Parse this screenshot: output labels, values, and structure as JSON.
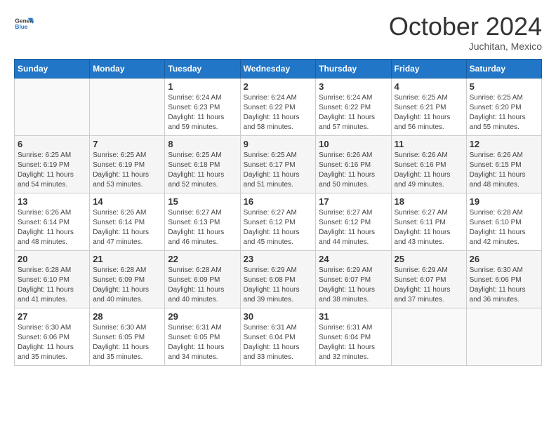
{
  "header": {
    "logo": {
      "general": "General",
      "blue": "Blue"
    },
    "title": "October 2024",
    "subtitle": "Juchitan, Mexico"
  },
  "calendar": {
    "days_of_week": [
      "Sunday",
      "Monday",
      "Tuesday",
      "Wednesday",
      "Thursday",
      "Friday",
      "Saturday"
    ],
    "weeks": [
      [
        {
          "day": "",
          "sunrise": "",
          "sunset": "",
          "daylight": ""
        },
        {
          "day": "",
          "sunrise": "",
          "sunset": "",
          "daylight": ""
        },
        {
          "day": "1",
          "sunrise": "Sunrise: 6:24 AM",
          "sunset": "Sunset: 6:23 PM",
          "daylight": "Daylight: 11 hours and 59 minutes."
        },
        {
          "day": "2",
          "sunrise": "Sunrise: 6:24 AM",
          "sunset": "Sunset: 6:22 PM",
          "daylight": "Daylight: 11 hours and 58 minutes."
        },
        {
          "day": "3",
          "sunrise": "Sunrise: 6:24 AM",
          "sunset": "Sunset: 6:22 PM",
          "daylight": "Daylight: 11 hours and 57 minutes."
        },
        {
          "day": "4",
          "sunrise": "Sunrise: 6:25 AM",
          "sunset": "Sunset: 6:21 PM",
          "daylight": "Daylight: 11 hours and 56 minutes."
        },
        {
          "day": "5",
          "sunrise": "Sunrise: 6:25 AM",
          "sunset": "Sunset: 6:20 PM",
          "daylight": "Daylight: 11 hours and 55 minutes."
        }
      ],
      [
        {
          "day": "6",
          "sunrise": "Sunrise: 6:25 AM",
          "sunset": "Sunset: 6:19 PM",
          "daylight": "Daylight: 11 hours and 54 minutes."
        },
        {
          "day": "7",
          "sunrise": "Sunrise: 6:25 AM",
          "sunset": "Sunset: 6:19 PM",
          "daylight": "Daylight: 11 hours and 53 minutes."
        },
        {
          "day": "8",
          "sunrise": "Sunrise: 6:25 AM",
          "sunset": "Sunset: 6:18 PM",
          "daylight": "Daylight: 11 hours and 52 minutes."
        },
        {
          "day": "9",
          "sunrise": "Sunrise: 6:25 AM",
          "sunset": "Sunset: 6:17 PM",
          "daylight": "Daylight: 11 hours and 51 minutes."
        },
        {
          "day": "10",
          "sunrise": "Sunrise: 6:26 AM",
          "sunset": "Sunset: 6:16 PM",
          "daylight": "Daylight: 11 hours and 50 minutes."
        },
        {
          "day": "11",
          "sunrise": "Sunrise: 6:26 AM",
          "sunset": "Sunset: 6:16 PM",
          "daylight": "Daylight: 11 hours and 49 minutes."
        },
        {
          "day": "12",
          "sunrise": "Sunrise: 6:26 AM",
          "sunset": "Sunset: 6:15 PM",
          "daylight": "Daylight: 11 hours and 48 minutes."
        }
      ],
      [
        {
          "day": "13",
          "sunrise": "Sunrise: 6:26 AM",
          "sunset": "Sunset: 6:14 PM",
          "daylight": "Daylight: 11 hours and 48 minutes."
        },
        {
          "day": "14",
          "sunrise": "Sunrise: 6:26 AM",
          "sunset": "Sunset: 6:14 PM",
          "daylight": "Daylight: 11 hours and 47 minutes."
        },
        {
          "day": "15",
          "sunrise": "Sunrise: 6:27 AM",
          "sunset": "Sunset: 6:13 PM",
          "daylight": "Daylight: 11 hours and 46 minutes."
        },
        {
          "day": "16",
          "sunrise": "Sunrise: 6:27 AM",
          "sunset": "Sunset: 6:12 PM",
          "daylight": "Daylight: 11 hours and 45 minutes."
        },
        {
          "day": "17",
          "sunrise": "Sunrise: 6:27 AM",
          "sunset": "Sunset: 6:12 PM",
          "daylight": "Daylight: 11 hours and 44 minutes."
        },
        {
          "day": "18",
          "sunrise": "Sunrise: 6:27 AM",
          "sunset": "Sunset: 6:11 PM",
          "daylight": "Daylight: 11 hours and 43 minutes."
        },
        {
          "day": "19",
          "sunrise": "Sunrise: 6:28 AM",
          "sunset": "Sunset: 6:10 PM",
          "daylight": "Daylight: 11 hours and 42 minutes."
        }
      ],
      [
        {
          "day": "20",
          "sunrise": "Sunrise: 6:28 AM",
          "sunset": "Sunset: 6:10 PM",
          "daylight": "Daylight: 11 hours and 41 minutes."
        },
        {
          "day": "21",
          "sunrise": "Sunrise: 6:28 AM",
          "sunset": "Sunset: 6:09 PM",
          "daylight": "Daylight: 11 hours and 40 minutes."
        },
        {
          "day": "22",
          "sunrise": "Sunrise: 6:28 AM",
          "sunset": "Sunset: 6:09 PM",
          "daylight": "Daylight: 11 hours and 40 minutes."
        },
        {
          "day": "23",
          "sunrise": "Sunrise: 6:29 AM",
          "sunset": "Sunset: 6:08 PM",
          "daylight": "Daylight: 11 hours and 39 minutes."
        },
        {
          "day": "24",
          "sunrise": "Sunrise: 6:29 AM",
          "sunset": "Sunset: 6:07 PM",
          "daylight": "Daylight: 11 hours and 38 minutes."
        },
        {
          "day": "25",
          "sunrise": "Sunrise: 6:29 AM",
          "sunset": "Sunset: 6:07 PM",
          "daylight": "Daylight: 11 hours and 37 minutes."
        },
        {
          "day": "26",
          "sunrise": "Sunrise: 6:30 AM",
          "sunset": "Sunset: 6:06 PM",
          "daylight": "Daylight: 11 hours and 36 minutes."
        }
      ],
      [
        {
          "day": "27",
          "sunrise": "Sunrise: 6:30 AM",
          "sunset": "Sunset: 6:06 PM",
          "daylight": "Daylight: 11 hours and 35 minutes."
        },
        {
          "day": "28",
          "sunrise": "Sunrise: 6:30 AM",
          "sunset": "Sunset: 6:05 PM",
          "daylight": "Daylight: 11 hours and 35 minutes."
        },
        {
          "day": "29",
          "sunrise": "Sunrise: 6:31 AM",
          "sunset": "Sunset: 6:05 PM",
          "daylight": "Daylight: 11 hours and 34 minutes."
        },
        {
          "day": "30",
          "sunrise": "Sunrise: 6:31 AM",
          "sunset": "Sunset: 6:04 PM",
          "daylight": "Daylight: 11 hours and 33 minutes."
        },
        {
          "day": "31",
          "sunrise": "Sunrise: 6:31 AM",
          "sunset": "Sunset: 6:04 PM",
          "daylight": "Daylight: 11 hours and 32 minutes."
        },
        {
          "day": "",
          "sunrise": "",
          "sunset": "",
          "daylight": ""
        },
        {
          "day": "",
          "sunrise": "",
          "sunset": "",
          "daylight": ""
        }
      ]
    ]
  }
}
